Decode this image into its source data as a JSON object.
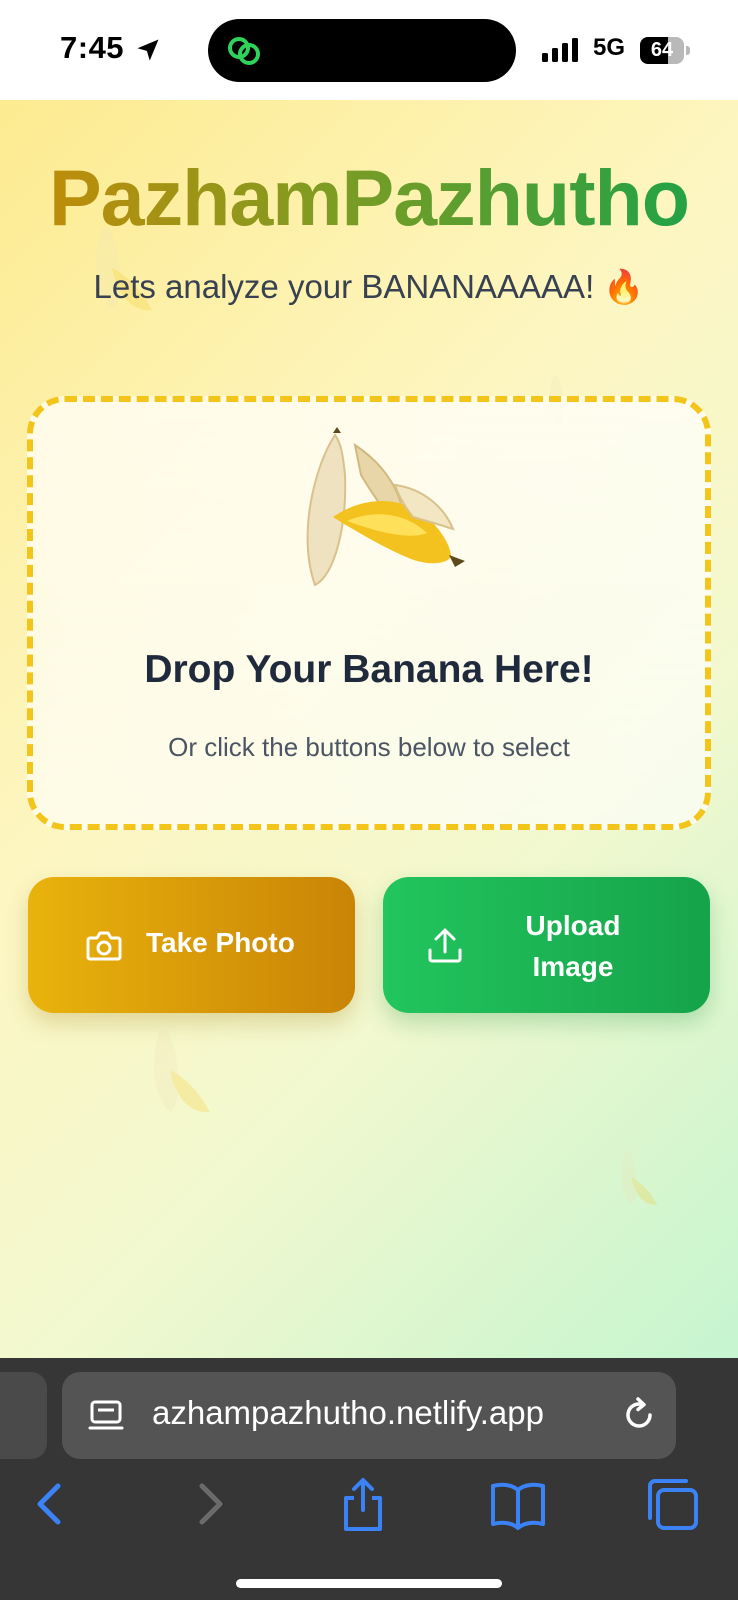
{
  "status_bar": {
    "time": "7:45",
    "network": "5G",
    "battery_percent": "64",
    "battery_level": 0.64
  },
  "app": {
    "title": "PazhamPazhutho",
    "subtitle": "Lets analyze your BANANAAAAA! 🔥",
    "drop_zone": {
      "title": "Drop Your Banana Here!",
      "hint": "Or click the buttons below to select"
    },
    "buttons": {
      "take_photo": "Take Photo",
      "upload_line1": "Upload",
      "upload_line2": "Image"
    },
    "colors": {
      "title_gradient_start": "#c98a06",
      "title_gradient_end": "#16a34a",
      "photo_button": "#e0a20a",
      "upload_button": "#1fb653",
      "drop_border": "#f3c41a"
    }
  },
  "browser": {
    "url": "azhampazhutho.netlify.app",
    "icons": [
      "page-settings-icon",
      "reload-icon",
      "back-icon",
      "forward-icon",
      "share-icon",
      "bookmarks-icon",
      "tabs-icon"
    ]
  }
}
